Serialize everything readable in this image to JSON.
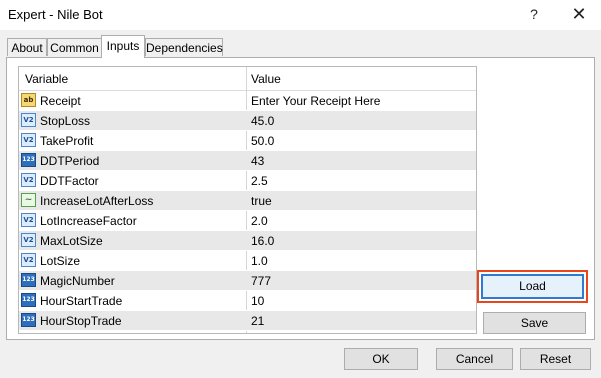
{
  "window": {
    "title": "Expert - Nile Bot",
    "help_glyph": "?",
    "close_glyph": "✕"
  },
  "tabs": [
    {
      "label": "About",
      "active": false
    },
    {
      "label": "Common",
      "active": false
    },
    {
      "label": "Inputs",
      "active": true
    },
    {
      "label": "Dependencies",
      "active": false
    }
  ],
  "table": {
    "headers": {
      "variable": "Variable",
      "value": "Value"
    },
    "rows": [
      {
        "icon": "ab",
        "name": "Receipt",
        "value": "Enter Your Receipt Here"
      },
      {
        "icon": "V2",
        "name": "StopLoss",
        "value": "45.0"
      },
      {
        "icon": "V2",
        "name": "TakeProfit",
        "value": "50.0"
      },
      {
        "icon": "123",
        "name": "DDTPeriod",
        "value": "43"
      },
      {
        "icon": "V2",
        "name": "DDTFactor",
        "value": "2.5"
      },
      {
        "icon": "~",
        "name": "IncreaseLotAfterLoss",
        "value": "true"
      },
      {
        "icon": "V2",
        "name": "LotIncreaseFactor",
        "value": "2.0"
      },
      {
        "icon": "V2",
        "name": "MaxLotSize",
        "value": "16.0"
      },
      {
        "icon": "V2",
        "name": "LotSize",
        "value": "1.0"
      },
      {
        "icon": "123",
        "name": "MagicNumber",
        "value": "777"
      },
      {
        "icon": "123",
        "name": "HourStartTrade",
        "value": "10"
      },
      {
        "icon": "123",
        "name": "HourStopTrade",
        "value": "21"
      }
    ]
  },
  "side_buttons": {
    "load": "Load",
    "save": "Save"
  },
  "footer_buttons": {
    "ok": "OK",
    "cancel": "Cancel",
    "reset": "Reset"
  },
  "colors": {
    "highlight": "#e8471d",
    "focus": "#2e7bd1",
    "alt_row": "#e8e8e8"
  }
}
